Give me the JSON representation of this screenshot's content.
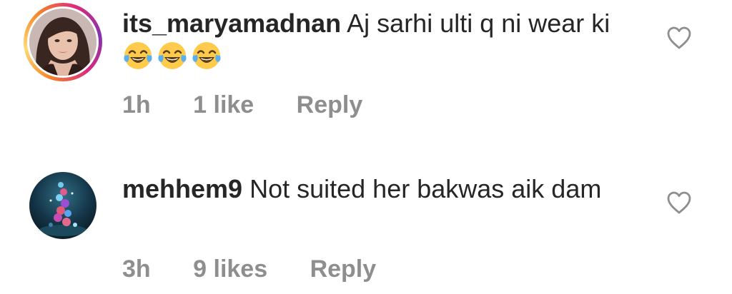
{
  "comments": [
    {
      "username": "its_maryamadnan",
      "text": "Aj sarhi ulti q ni wear ki",
      "emoji_icon": "face-with-tears-of-joy-icon",
      "emoji_count": 3,
      "time": "1h",
      "likes": "1 like",
      "reply_label": "Reply",
      "has_story_ring": true
    },
    {
      "username": "mehhem9",
      "text": "Not suited her bakwas aik dam",
      "time": "3h",
      "likes": "9 likes",
      "reply_label": "Reply",
      "has_story_ring": false
    }
  ],
  "colors": {
    "text": "#262626",
    "meta": "#8e8e8e",
    "heart_outline": "#8e8e8e",
    "story_ring": [
      "#f58529",
      "#dd2a7b",
      "#8134af"
    ]
  },
  "icons": {
    "like": "heart-outline-icon"
  }
}
